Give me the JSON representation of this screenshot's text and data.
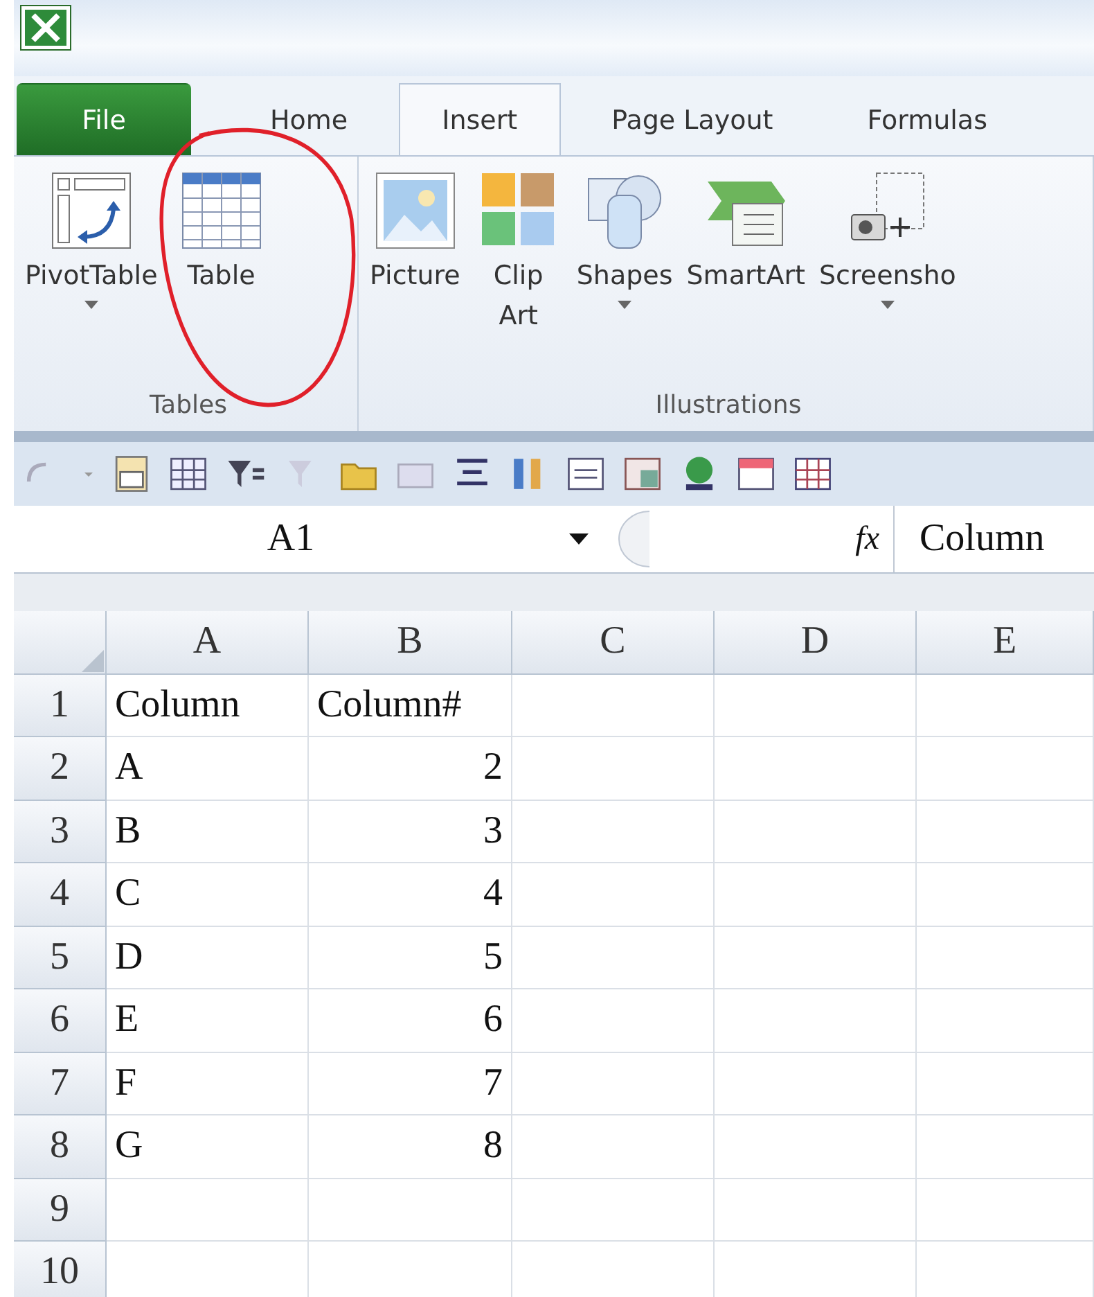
{
  "tabs": [
    {
      "label": "File",
      "kind": "backstage",
      "selected": false
    },
    {
      "label": "Home",
      "kind": "tab",
      "selected": false
    },
    {
      "label": "Insert",
      "kind": "tab",
      "selected": true
    },
    {
      "label": "Page Layout",
      "kind": "tab",
      "selected": false
    },
    {
      "label": "Formulas",
      "kind": "tab",
      "selected": false
    }
  ],
  "ribbon": {
    "groups": [
      {
        "label": "Tables",
        "buttons": [
          {
            "label": "PivotTable",
            "has_menu": true
          },
          {
            "label": "Table",
            "has_menu": false
          }
        ]
      },
      {
        "label": "Illustrations",
        "buttons": [
          {
            "label": "Picture",
            "has_menu": false
          },
          {
            "label": "Clip\nArt",
            "has_menu": false
          },
          {
            "label": "Shapes",
            "has_menu": true
          },
          {
            "label": "SmartArt",
            "has_menu": false
          },
          {
            "label": "Screensho",
            "has_menu": true
          }
        ]
      }
    ]
  },
  "formula_bar": {
    "name_box": "A1",
    "function_label": "fx",
    "content": "Column"
  },
  "sheet": {
    "columns": [
      "A",
      "B",
      "C",
      "D",
      "E"
    ],
    "rows": [
      {
        "number": "1",
        "cells": [
          {
            "text": "Column",
            "kind": "text"
          },
          {
            "text": "Column#",
            "kind": "text"
          }
        ]
      },
      {
        "number": "2",
        "cells": [
          {
            "text": "A",
            "kind": "text"
          },
          {
            "text": "2",
            "kind": "number"
          }
        ]
      },
      {
        "number": "3",
        "cells": [
          {
            "text": "B",
            "kind": "text"
          },
          {
            "text": "3",
            "kind": "number"
          }
        ]
      },
      {
        "number": "4",
        "cells": [
          {
            "text": "C",
            "kind": "text"
          },
          {
            "text": "4",
            "kind": "number"
          }
        ]
      },
      {
        "number": "5",
        "cells": [
          {
            "text": "D",
            "kind": "text"
          },
          {
            "text": "5",
            "kind": "number"
          }
        ]
      },
      {
        "number": "6",
        "cells": [
          {
            "text": "E",
            "kind": "text"
          },
          {
            "text": "6",
            "kind": "number"
          }
        ]
      },
      {
        "number": "7",
        "cells": [
          {
            "text": "F",
            "kind": "text"
          },
          {
            "text": "7",
            "kind": "number"
          }
        ]
      },
      {
        "number": "8",
        "cells": [
          {
            "text": "G",
            "kind": "text"
          },
          {
            "text": "8",
            "kind": "number"
          }
        ]
      },
      {
        "number": "9",
        "cells": []
      },
      {
        "number": "10",
        "cells": []
      }
    ]
  }
}
